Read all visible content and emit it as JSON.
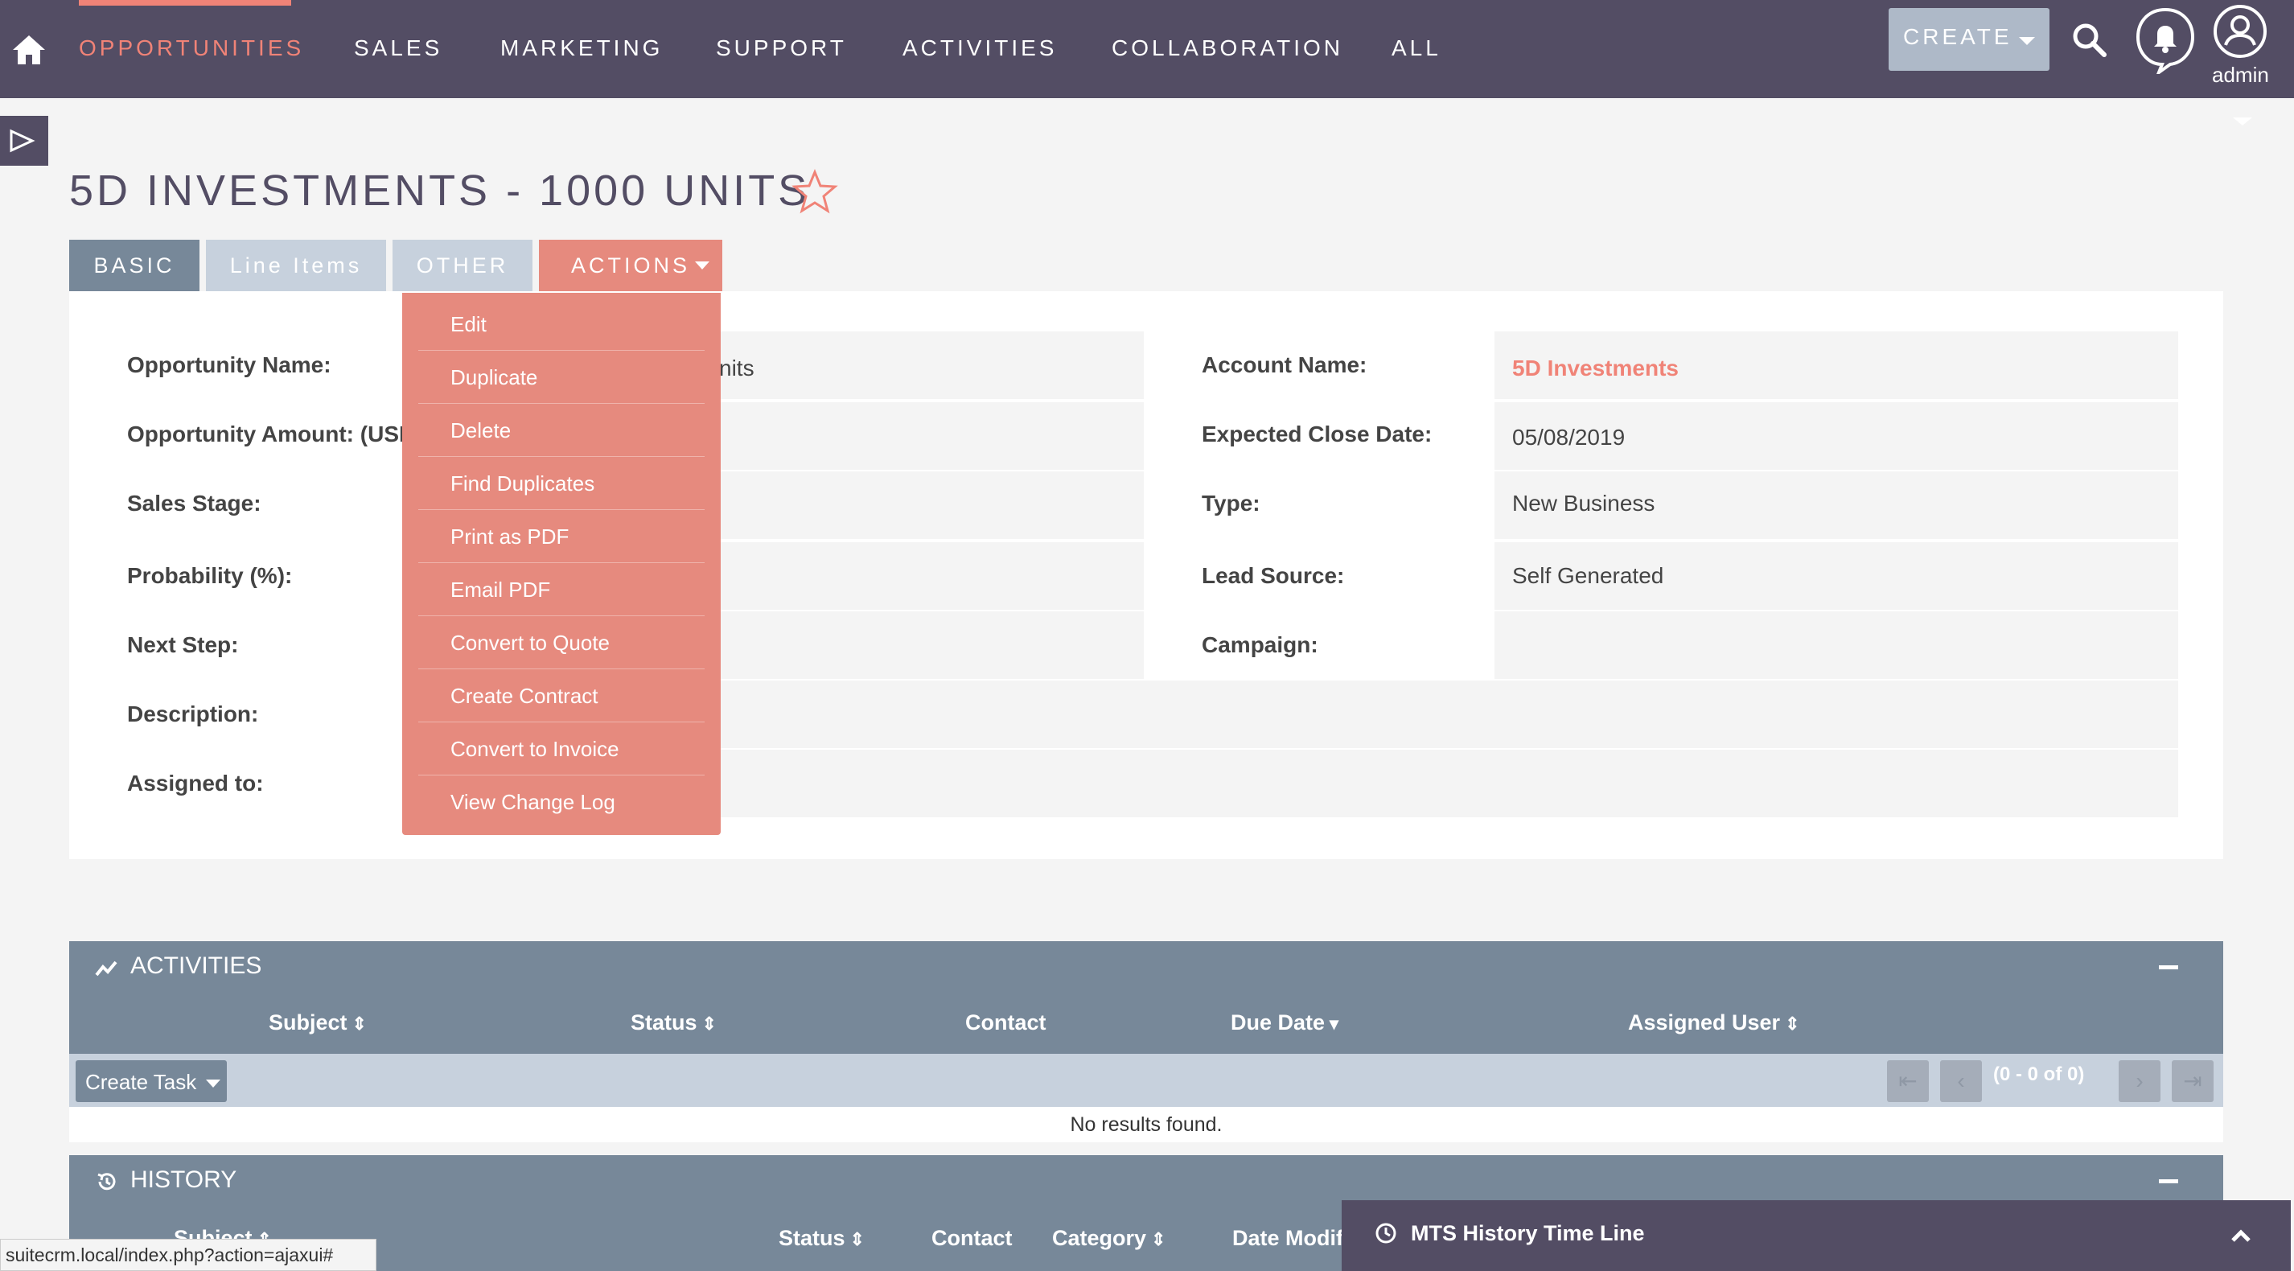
{
  "nav": {
    "items": [
      "OPPORTUNITIES",
      "SALES",
      "MARKETING",
      "SUPPORT",
      "ACTIVITIES",
      "COLLABORATION",
      "ALL"
    ],
    "create_label": "CREATE",
    "user_label": "admin",
    "colors": {
      "bar": "#534d64",
      "accent": "#f08377"
    }
  },
  "page": {
    "title": "5D INVESTMENTS - 1000 UNITS"
  },
  "tabs": [
    "BASIC",
    "Line Items",
    "OTHER",
    "ACTIONS"
  ],
  "fields_left": [
    {
      "label": "Opportunity Name:",
      "value": "5D Investments - 1000 Units",
      "value_visible": "nits"
    },
    {
      "label": "Opportunity Amount: (USD $)",
      "label_visible": "Opportunity Amount: (USI",
      "value": ""
    },
    {
      "label": "Sales Stage:",
      "value": ""
    },
    {
      "label": "Probability (%):",
      "value": ""
    },
    {
      "label": "Next Step:",
      "value": ""
    },
    {
      "label": "Description:",
      "value": ""
    },
    {
      "label": "Assigned to:",
      "value": ""
    }
  ],
  "fields_right": [
    {
      "label": "Account Name:",
      "value": "5D Investments"
    },
    {
      "label": "Expected Close Date:",
      "value": "05/08/2019"
    },
    {
      "label": "Type:",
      "value": "New Business"
    },
    {
      "label": "Lead Source:",
      "value": "Self Generated"
    },
    {
      "label": "Campaign:",
      "value": ""
    }
  ],
  "actions_menu": [
    "Edit",
    "Duplicate",
    "Delete",
    "Find Duplicates",
    "Print as PDF",
    "Email PDF",
    "Convert to Quote",
    "Create Contract",
    "Convert to Invoice",
    "View Change Log"
  ],
  "activities": {
    "title": "ACTIVITIES",
    "columns": [
      "Subject",
      "Status",
      "Contact",
      "Due Date",
      "Assigned User"
    ],
    "create_task_label": "Create Task",
    "pagination": "(0 - 0 of 0)",
    "empty_text": "No results found."
  },
  "history": {
    "title": "HISTORY",
    "columns": [
      "Subject",
      "Status",
      "Contact",
      "Category",
      "Date Modif"
    ]
  },
  "mts_bar": {
    "title": "MTS History Time Line"
  },
  "status_url": "suitecrm.local/index.php?action=ajaxui#"
}
